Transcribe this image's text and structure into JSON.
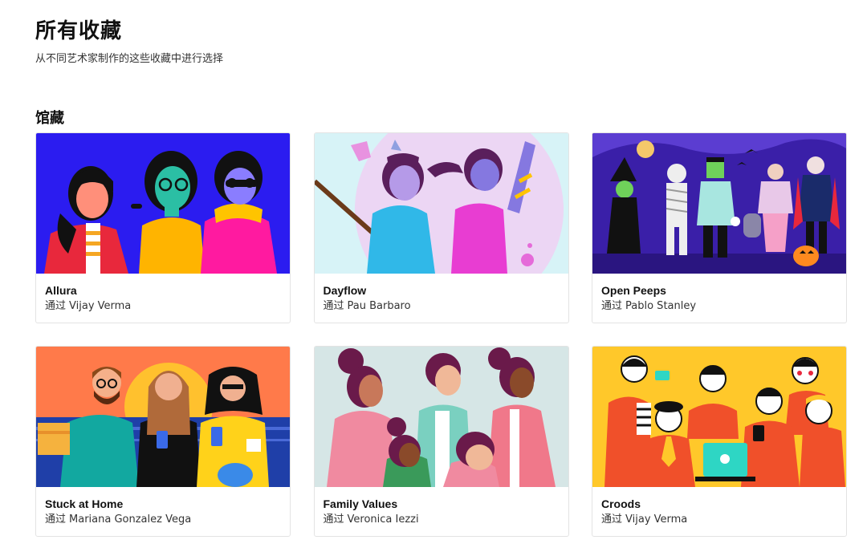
{
  "header": {
    "title": "所有收藏",
    "subtitle": "从不同艺术家制作的这些收藏中进行选择"
  },
  "section": {
    "title": "馆藏"
  },
  "by_label": "通过",
  "collections": [
    {
      "name": "Allura",
      "author": "Vijay Verma",
      "bg": "#2b1cf0"
    },
    {
      "name": "Dayflow",
      "author": "Pau Barbaro",
      "bg": "#d7f3f7"
    },
    {
      "name": "Open Peeps",
      "author": "Pablo Stanley",
      "bg": "#3a1fa8"
    },
    {
      "name": "Stuck at Home",
      "author": "Mariana Gonzalez Vega",
      "bg": "#ff7a4a"
    },
    {
      "name": "Family Values",
      "author": "Veronica Iezzi",
      "bg": "#d6e6e6"
    },
    {
      "name": "Croods",
      "author": "Vijay Verma",
      "bg": "#ffc82a"
    }
  ]
}
